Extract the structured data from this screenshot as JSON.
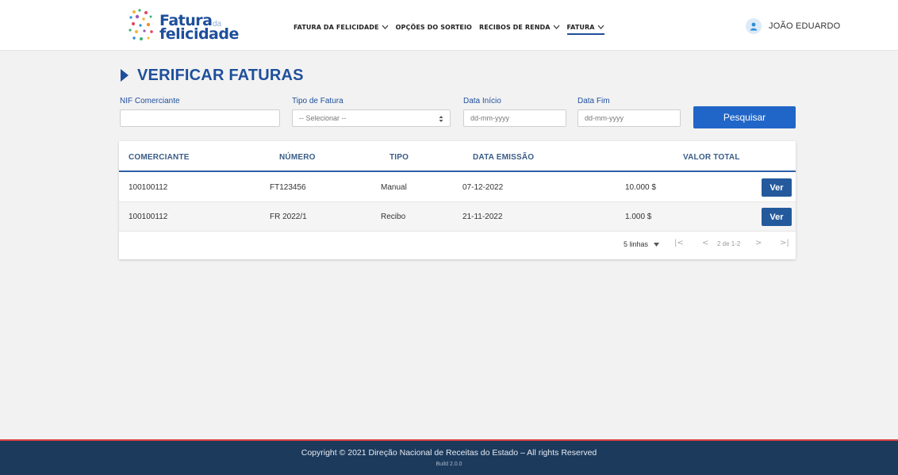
{
  "app": {
    "logo_word1": "Fatura",
    "logo_da": "da",
    "logo_word2": "felicidade"
  },
  "nav": {
    "items": [
      {
        "label": "FATURA DA FELICIDADE",
        "has_dropdown": true,
        "active": false
      },
      {
        "label": "OPÇÕES DO SORTEIO",
        "has_dropdown": false,
        "active": false
      },
      {
        "label": "RECIBOS DE RENDA",
        "has_dropdown": true,
        "active": false
      },
      {
        "label": "FATURA",
        "has_dropdown": true,
        "active": true
      }
    ],
    "user_name": "JOÃO EDUARDO",
    "user_icon": "user-avatar-icon"
  },
  "page": {
    "title": "VERIFICAR FATURAS",
    "title_icon": "play-triangle-icon"
  },
  "filters": {
    "nif_label": "NIF Comerciante",
    "nif_value": "",
    "tipo_label": "Tipo de Fatura",
    "tipo_selected": "-- Selecionar --",
    "data_inicio_label": "Data Início",
    "data_inicio_placeholder": "dd-mm-yyyy",
    "data_fim_label": "Data Fim",
    "data_fim_placeholder": "dd-mm-yyyy",
    "search_label": "Pesquisar"
  },
  "table": {
    "columns": [
      "COMERCIANTE",
      "NÚMERO",
      "TIPO",
      "DATA EMISSÃO",
      "VALOR TOTAL"
    ],
    "rows": [
      {
        "comerciante": "100100112",
        "numero": "FT123456",
        "tipo": "Manual",
        "data": "07-12-2022",
        "valor": "10.000 $",
        "action": "Ver"
      },
      {
        "comerciante": "100100112",
        "numero": "FR 2022/1",
        "tipo": "Recibo",
        "data": "21-11-2022",
        "valor": "1.000 $",
        "action": "Ver"
      }
    ],
    "pagination": {
      "rows_per_page": "5 linhas",
      "page_info": "2 de 1-2",
      "first": "|<",
      "prev": "<",
      "next": ">",
      "last": ">|"
    }
  },
  "footer": {
    "copyright": "Copyright © 2021 Direção Nacional de Receitas do Estado – All rights Reserved",
    "build": "Build 2.0.0"
  },
  "colors": {
    "brand": "#1e4f9c",
    "primary_button": "#2066c8",
    "ver_button": "#245a9c",
    "footer_bg": "#1c3a5c",
    "footer_accent": "#d94040"
  }
}
